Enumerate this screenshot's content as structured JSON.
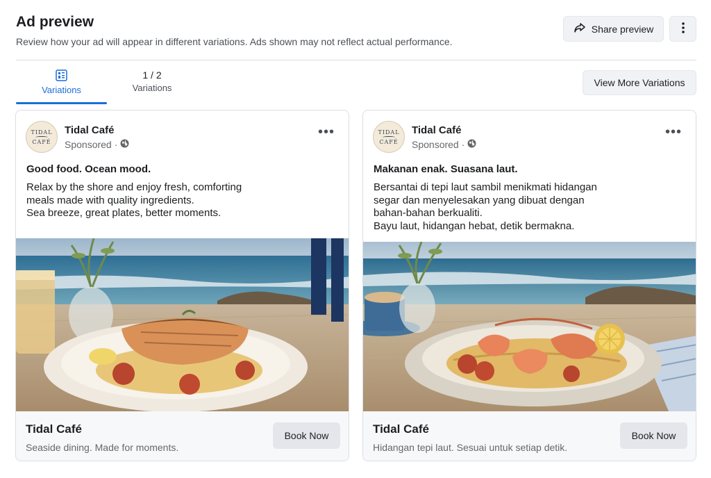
{
  "header": {
    "title": "Ad preview",
    "subtitle": "Review how your ad will appear in different variations. Ads shown may not reflect actual performance.",
    "share_label": "Share preview",
    "share_icon": "share-arrow-icon",
    "more_icon": "vertical-dots-icon"
  },
  "tabs": {
    "variations_label": "Variations",
    "variations_icon": "grid-icon",
    "count_value": "1 / 2",
    "count_label": "Variations",
    "view_more_label": "View More Variations"
  },
  "colors": {
    "accent": "#1a6ed8",
    "button_bg": "#f0f2f5"
  },
  "cards": [
    {
      "brand": "Tidal Café",
      "logo_top": "TIDAL",
      "logo_bottom": "CAFÉ",
      "sponsored": "Sponsored ·",
      "headline": "Good food. Ocean mood.",
      "body": [
        "Relax by the shore and enjoy fresh, comforting",
        "meals made with quality ingredients.",
        "Sea breeze, great plates, better moments."
      ],
      "image": "grilled-salmon-pasta-seaside",
      "footer_title": "Tidal Café",
      "footer_desc": "Seaside dining. Made for moments.",
      "cta": "Book Now"
    },
    {
      "brand": "Tidal Café",
      "logo_top": "TIDAL",
      "logo_bottom": "CAFÉ",
      "sponsored": "Sponsored ·",
      "headline": "Makanan enak. Suasana laut.",
      "body": [
        "Bersantai di tepi laut sambil menikmati hidangan",
        "segar dan menyelesakan yang dibuat dengan",
        "bahan-bahan berkualiti.",
        "Bayu laut, hidangan hebat, detik bermakna."
      ],
      "image": "shrimp-pasta-seaside",
      "footer_title": "Tidal Café",
      "footer_desc": "Hidangan tepi laut. Sesuai untuk setiap detik.",
      "cta": "Book Now"
    }
  ]
}
